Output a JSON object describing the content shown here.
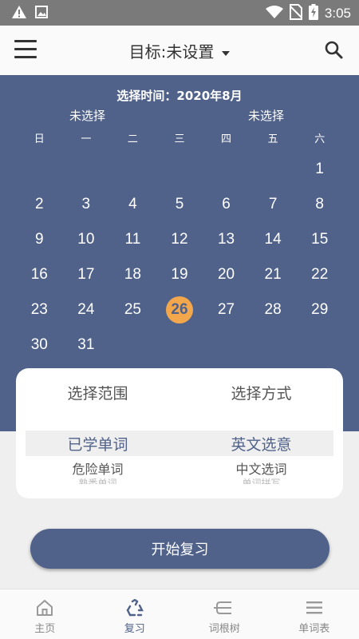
{
  "status": {
    "time": "3:05"
  },
  "header": {
    "title": "目标:未设置"
  },
  "calendar": {
    "title": "选择时间：2020年8月",
    "selection_left": "未选择",
    "selection_right": "未选择",
    "weekdays": [
      "日",
      "一",
      "二",
      "三",
      "四",
      "五",
      "六"
    ],
    "leading_blanks": 6,
    "days": [
      "1",
      "2",
      "3",
      "4",
      "5",
      "6",
      "7",
      "8",
      "9",
      "10",
      "11",
      "12",
      "13",
      "14",
      "15",
      "16",
      "17",
      "18",
      "19",
      "20",
      "21",
      "22",
      "23",
      "24",
      "25",
      "26",
      "27",
      "28",
      "29",
      "30",
      "31"
    ],
    "today": "26",
    "today_color": "#f2a74d"
  },
  "picker": {
    "range": {
      "header": "选择范围",
      "selected": "已学单词",
      "next": "危险单词",
      "faded": "熟悉单词"
    },
    "mode": {
      "header": "选择方式",
      "selected": "英文选意",
      "next": "中文选词",
      "faded": "单词拼写"
    }
  },
  "start_button": "开始复习",
  "nav": [
    {
      "label": "主页",
      "icon": "home-icon"
    },
    {
      "label": "复习",
      "icon": "recycle-icon",
      "active": true
    },
    {
      "label": "词根树",
      "icon": "root-tree-icon"
    },
    {
      "label": "单词表",
      "icon": "list-icon"
    }
  ],
  "colors": {
    "primary": "#50628a",
    "accent": "#f2a74d"
  }
}
